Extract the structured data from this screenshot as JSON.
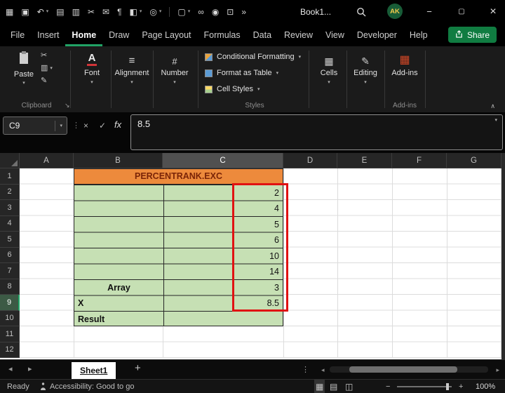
{
  "colors": {
    "excel_green": "#21a366",
    "share_green": "#107c41",
    "cell_green": "#c6e0b4",
    "cell_orange": "#ed8a3c",
    "title_text": "#7a2407",
    "annotation_red": "#e01212"
  },
  "glyphs": {
    "chevron_down": "▾",
    "chevron_up": "∧",
    "chevron_left": "◂",
    "chevron_right": "▸",
    "more": "»",
    "dots_v": "⋮",
    "minimize": "−",
    "restore": "▢",
    "close": "×",
    "cancel": "×",
    "check": "✓",
    "dialog_launcher": "↘",
    "font_a": "A",
    "align_lines": "≡",
    "number_sign": "#",
    "cells_grid": "▦",
    "editing_pencil": "✎",
    "addins_grid": "▦",
    "cut": "✂",
    "copy": "▥",
    "format_painter": "✎",
    "normal_view": "▦",
    "page_layout_view": "▤",
    "page_break_view": "◫",
    "zoom_out": "−",
    "zoom_in": "+",
    "plus": "+"
  },
  "titlebar": {
    "title": "Book1...",
    "avatar": "AK",
    "qat": [
      {
        "name": "app-launcher",
        "glyph": "▦"
      },
      {
        "name": "save",
        "glyph": "▣"
      },
      {
        "name": "undo",
        "glyph": "↶"
      },
      {
        "name": "print",
        "glyph": "▤"
      },
      {
        "name": "copy",
        "glyph": "▥"
      },
      {
        "name": "cut",
        "glyph": "✂"
      },
      {
        "name": "mail",
        "glyph": "✉"
      },
      {
        "name": "formatting-marks",
        "glyph": "¶"
      },
      {
        "name": "fill-color",
        "glyph": "◧"
      },
      {
        "name": "record",
        "glyph": "◎"
      },
      {
        "name": "new-file",
        "glyph": "▢"
      },
      {
        "name": "link",
        "glyph": "∞"
      },
      {
        "name": "camera",
        "glyph": "◉"
      },
      {
        "name": "screen-clip",
        "glyph": "⊡"
      }
    ]
  },
  "menubar": {
    "items": [
      "File",
      "Insert",
      "Home",
      "Draw",
      "Page Layout",
      "Formulas",
      "Data",
      "Review",
      "View",
      "Developer",
      "Help"
    ],
    "active": "Home",
    "share": "Share"
  },
  "ribbon": {
    "paste": "Paste",
    "groups": {
      "clipboard": "Clipboard",
      "styles": "Styles",
      "addins": "Add-ins"
    },
    "buttons": {
      "font": "Font",
      "alignment": "Alignment",
      "number": "Number",
      "conditional_formatting": "Conditional Formatting",
      "format_as_table": "Format as Table",
      "cell_styles": "Cell Styles",
      "cells": "Cells",
      "editing": "Editing",
      "addins": "Add-ins"
    }
  },
  "formula_bar": {
    "cell_ref": "C9",
    "fx": "fx",
    "value": "8.5"
  },
  "sheet": {
    "columns": [
      "A",
      "B",
      "C",
      "D",
      "E",
      "F",
      "G"
    ],
    "rows": [
      "1",
      "2",
      "3",
      "4",
      "5",
      "6",
      "7",
      "8",
      "9",
      "10",
      "11",
      "12"
    ],
    "selected_column": "C",
    "selected_row": "9",
    "active_cell": "C9",
    "title": "PERCENTRANK.EXC",
    "array_label": "Array",
    "x_label": "X",
    "result_label": "Result",
    "values": [
      "2",
      "4",
      "5",
      "6",
      "10",
      "14",
      "3",
      "8.5"
    ]
  },
  "tabs": {
    "sheet1": "Sheet1",
    "add": "+"
  },
  "status": {
    "ready": "Ready",
    "accessibility": "Accessibility: Good to go",
    "zoom": "100%"
  }
}
